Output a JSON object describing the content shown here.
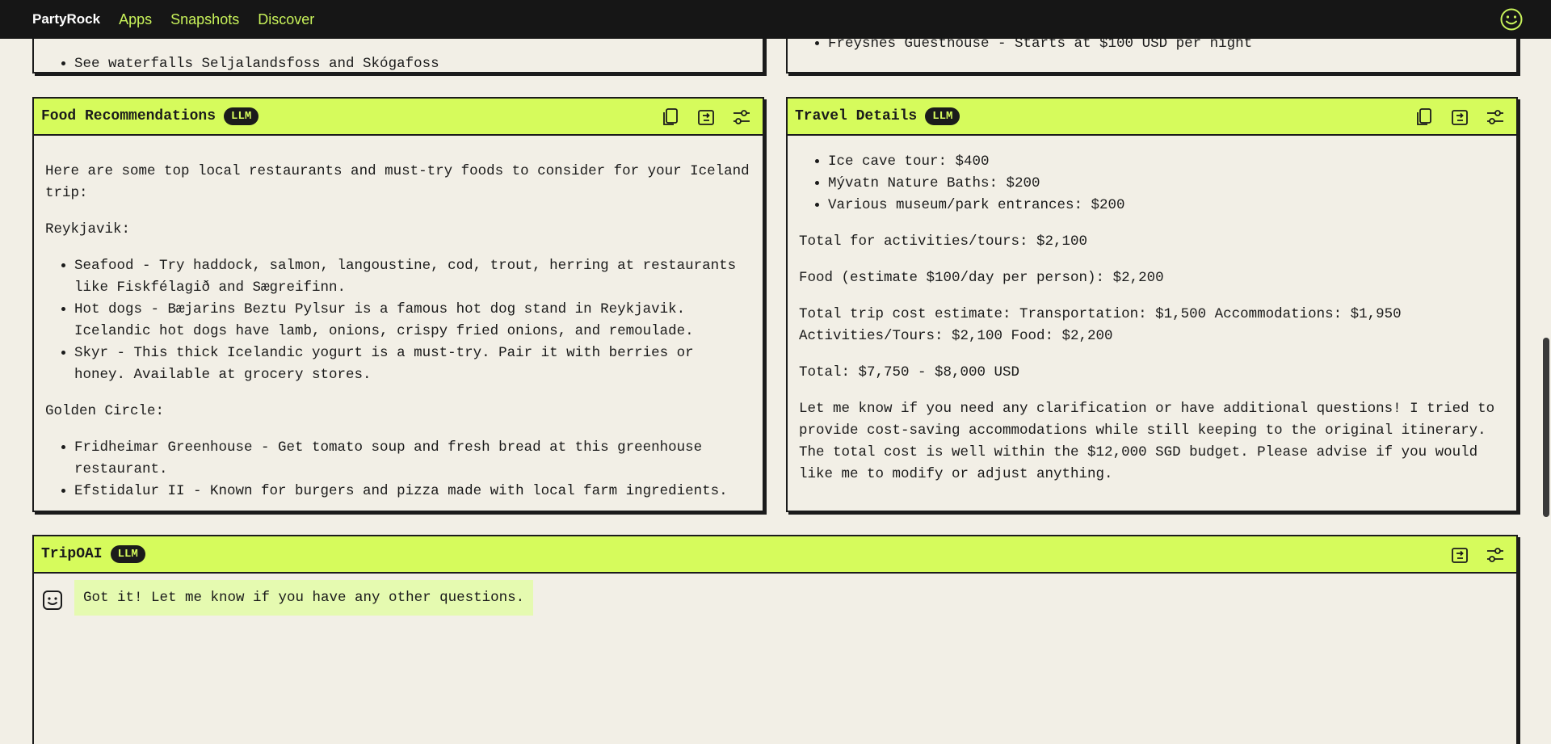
{
  "nav": {
    "logo": "PartyRock",
    "links": [
      "Apps",
      "Snapshots",
      "Discover"
    ],
    "profile_icon": "smiley-icon"
  },
  "top_left_card": {
    "partial_text": "See waterfalls Seljalandsfoss and Skógafoss"
  },
  "top_right_card": {
    "partial_text": "Freysnes Guesthouse - Starts at $100 USD per night"
  },
  "food_card": {
    "title": "Food Recommendations",
    "badge": "LLM",
    "intro": "Here are some top local restaurants and must-try foods to consider for your Iceland trip:",
    "section1": "Reykjavik:",
    "items1": [
      "Seafood - Try haddock, salmon, langoustine, cod, trout, herring at restaurants like Fiskfélagið and Sægreifinn.",
      "Hot dogs - Bæjarins Beztu Pylsur is a famous hot dog stand in Reykjavik. Icelandic hot dogs have lamb, onions, crispy fried onions, and remoulade.",
      "Skyr - This thick Icelandic yogurt is a must-try. Pair it with berries or honey. Available at grocery stores."
    ],
    "section2": "Golden Circle:",
    "items2": [
      "Fridheimar Greenhouse - Get tomato soup and fresh bread at this greenhouse restaurant.",
      "Efstidalur II - Known for burgers and pizza made with local farm ingredients."
    ]
  },
  "travel_card": {
    "title": "Travel Details",
    "badge": "LLM",
    "items": [
      "Ice cave tour: $400",
      "Mývatn Nature Baths: $200",
      "Various museum/park entrances: $200"
    ],
    "total_activities": "Total for activities/tours: $2,100",
    "food": "Food (estimate $100/day per person): $2,200",
    "total_estimate": "Total trip cost estimate: Transportation: $1,500 Accommodations: $1,950 Activities/Tours: $2,100 Food: $2,200",
    "total": "Total: $7,750 - $8,000 USD",
    "closing": "Let me know if you need any clarification or have additional questions! I tried to provide cost-saving accommodations while still keeping to the original itinerary. The total cost is well within the $12,000 SGD budget. Please advise if you would like me to modify or adjust anything."
  },
  "chat_card": {
    "title": "TripOAI",
    "badge": "LLM",
    "message": "Got it! Let me know if you have any other questions."
  },
  "icons": {
    "copy": "copy-icon",
    "export": "export-icon",
    "settings": "sliders-icon",
    "bot": "bot-avatar-icon"
  }
}
